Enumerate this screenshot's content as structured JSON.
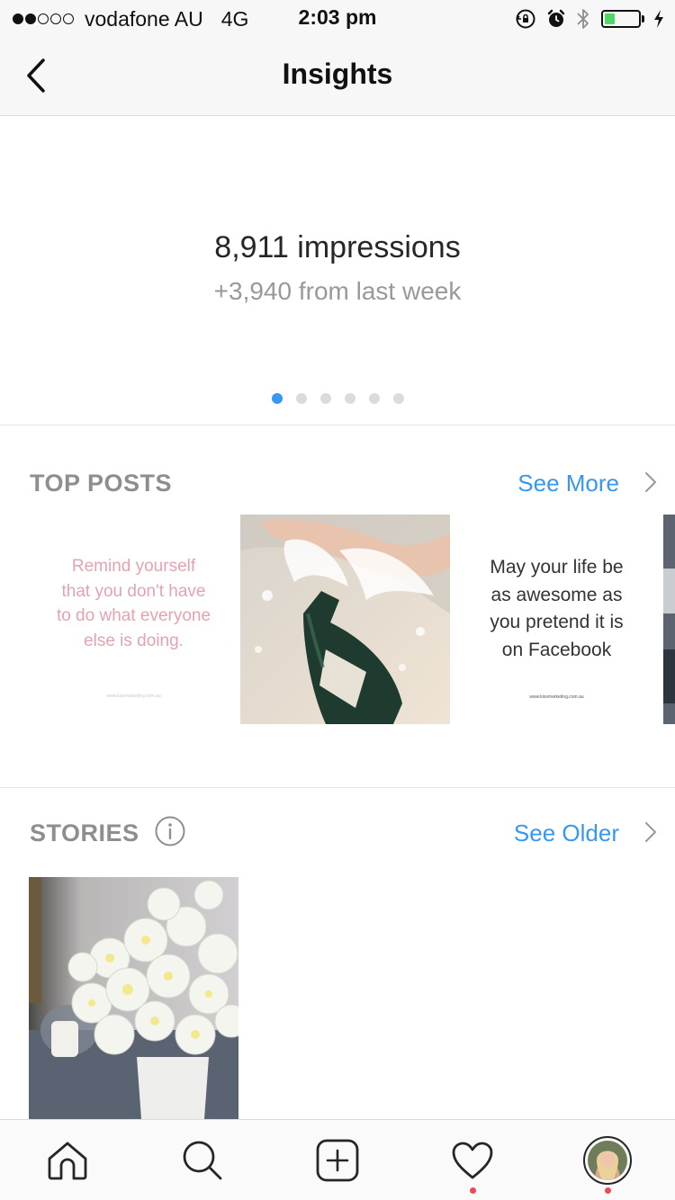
{
  "status_bar": {
    "carrier": "vodafone AU",
    "network": "4G",
    "time": "2:03 pm",
    "signal_bars_filled": 2,
    "signal_bars_total": 5,
    "battery_level": 0.3,
    "icons": [
      "orientation-lock-icon",
      "alarm-icon",
      "bluetooth-icon",
      "battery-icon",
      "charging-icon"
    ]
  },
  "nav": {
    "title": "Insights",
    "back_icon": "chevron-left-icon"
  },
  "impressions": {
    "headline": "8,911 impressions",
    "delta": "+3,940 from last week",
    "page_count": 6,
    "active_page": 1
  },
  "top_posts": {
    "title": "TOP POSTS",
    "see_label": "See More",
    "posts": [
      {
        "kind": "quote",
        "text_lines": [
          "Remind yourself",
          "that you don't have",
          "to do what everyone",
          "else is doing."
        ],
        "url": "www.kissmarketing.com.au"
      },
      {
        "kind": "photo",
        "subject": "champagne bottle spraying"
      },
      {
        "kind": "quote",
        "text_lines": [
          "May your life be",
          "as awesome as",
          "you pretend it is",
          "on Facebook"
        ],
        "url": "www.kissmarketing.com.au"
      },
      {
        "kind": "photo",
        "subject": "partial post"
      }
    ]
  },
  "stories": {
    "title": "STORIES",
    "info_icon": "info-icon",
    "see_label": "See Older",
    "items": [
      {
        "kind": "photo",
        "subject": "white chrysanthemums in vase"
      }
    ]
  },
  "tab_bar": {
    "tabs": [
      {
        "name": "home",
        "icon": "home-icon",
        "notification": false
      },
      {
        "name": "search",
        "icon": "search-icon",
        "notification": false
      },
      {
        "name": "new-post",
        "icon": "add-icon",
        "notification": false
      },
      {
        "name": "activity",
        "icon": "heart-icon",
        "notification": true
      },
      {
        "name": "profile",
        "icon": "avatar",
        "notification": true
      }
    ]
  },
  "colors": {
    "accent": "#3897f0",
    "notification": "#ed4956",
    "muted_text": "#8e8e8e",
    "battery_fill": "#4cd964"
  }
}
